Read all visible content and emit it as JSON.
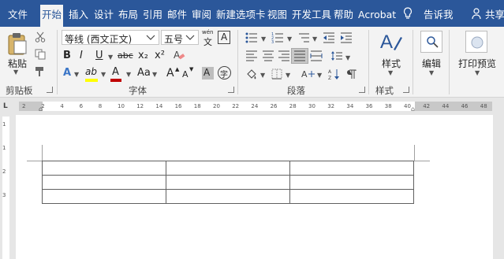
{
  "tabs": {
    "file": "文件",
    "home": "开始",
    "insert": "插入",
    "design": "设计",
    "layout": "布局",
    "references": "引用",
    "mailings": "邮件",
    "review": "审阅",
    "new_tab": "新建选项卡",
    "view": "视图",
    "developer": "开发工具",
    "help": "帮助",
    "acrobat": "Acrobat",
    "tell_me": "告诉我",
    "share": "共享"
  },
  "clipboard": {
    "paste_label": "粘贴",
    "group_label": "剪贴板"
  },
  "font": {
    "font_name": "等线 (西文正文)",
    "font_size": "五号",
    "wen_top": "wén",
    "wen_bottom": "文",
    "char_border": "A",
    "bold": "B",
    "italic": "I",
    "underline": "U",
    "strikethrough": "abc",
    "subscript": "x₂",
    "superscript": "x²",
    "text_effects": "A",
    "highlight": "ab",
    "font_color": "A",
    "change_case": "Aa",
    "grow": "A",
    "shrink": "A",
    "char_shading": "A",
    "enclose": "字",
    "group_label": "字体",
    "font_color_hex": "#c00000",
    "highlight_hex": "#ffff00"
  },
  "paragraph": {
    "group_label": "段落"
  },
  "styles": {
    "label": "样式",
    "group_label": "样式"
  },
  "editing": {
    "label": "编辑"
  },
  "print_preview": {
    "label": "打印预览"
  },
  "ruler": {
    "numbers": [
      "2",
      "2",
      "4",
      "6",
      "8",
      "10",
      "12",
      "14",
      "16",
      "18",
      "20",
      "22",
      "24",
      "26",
      "28",
      "30",
      "32",
      "34",
      "36",
      "38",
      "40",
      "42",
      "44",
      "46",
      "48"
    ]
  },
  "vruler": {
    "numbers": [
      "1",
      "1",
      "2",
      "3"
    ]
  },
  "document": {
    "table_rows": 3,
    "table_cols": 3
  }
}
